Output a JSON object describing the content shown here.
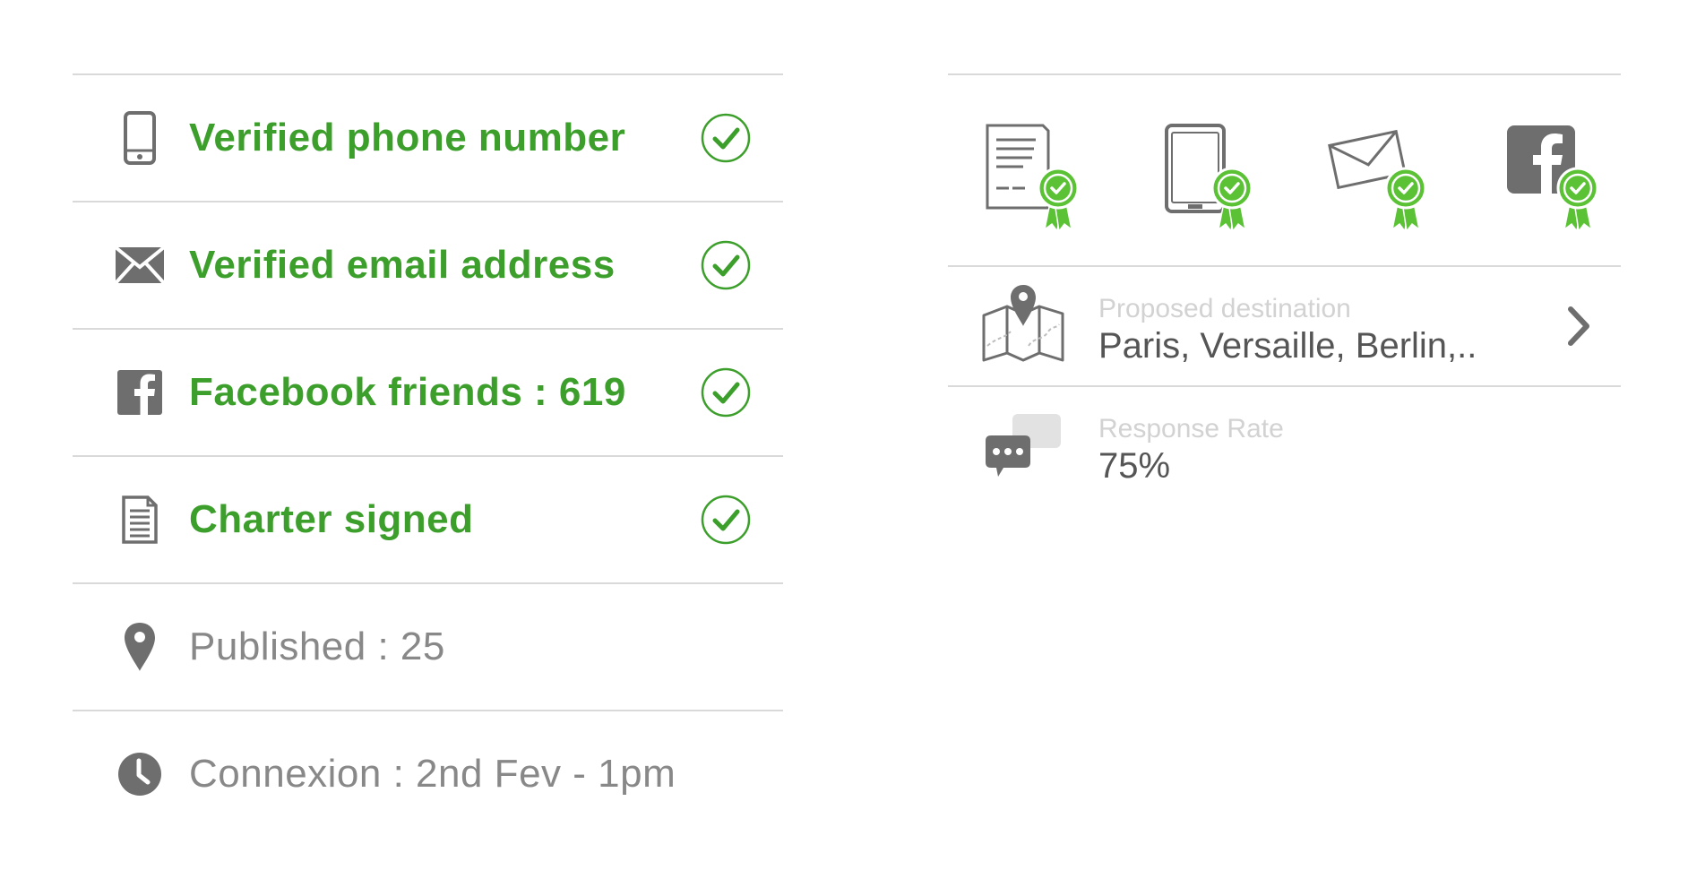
{
  "verifications": [
    {
      "icon": "phone-icon",
      "label": "Verified phone number",
      "verified": true
    },
    {
      "icon": "envelope-icon",
      "label": "Verified email address",
      "verified": true
    },
    {
      "icon": "facebook-icon",
      "label": "Facebook friends : 619",
      "verified": true
    },
    {
      "icon": "document-icon",
      "label": "Charter signed",
      "verified": true
    }
  ],
  "stats": {
    "published": "Published : 25",
    "connexion": "Connexion : 2nd Fev - 1pm"
  },
  "badges": [
    {
      "icon": "charter-badge-icon"
    },
    {
      "icon": "phone-badge-icon"
    },
    {
      "icon": "email-badge-icon"
    },
    {
      "icon": "facebook-badge-icon"
    }
  ],
  "destination": {
    "caption": "Proposed destination",
    "value": "Paris, Versaille, Berlin,.."
  },
  "response": {
    "caption": "Response Rate",
    "value": "75%"
  },
  "colors": {
    "verified_green": "#3d9f2b",
    "badge_green": "#5bc236",
    "icon_gray": "#6e6e6e",
    "divider": "#d9d9d9"
  }
}
